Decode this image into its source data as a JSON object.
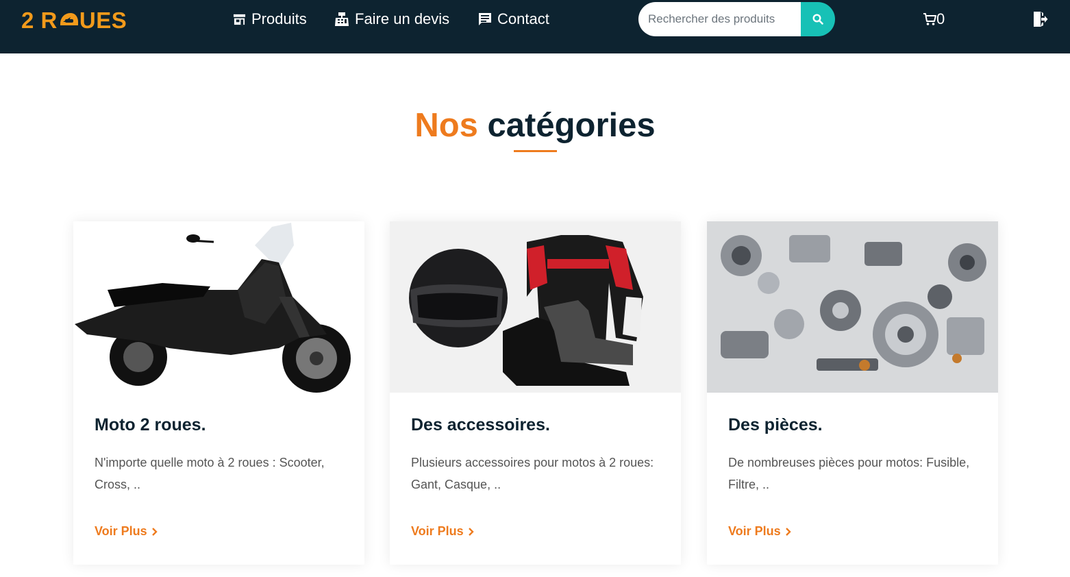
{
  "brand": {
    "logo_prefix": "2 R",
    "logo_suffix": "UES"
  },
  "nav": {
    "items": [
      {
        "label": "Produits",
        "icon": "store-icon"
      },
      {
        "label": "Faire un devis",
        "icon": "cash-register-icon"
      },
      {
        "label": "Contact",
        "icon": "message-icon"
      }
    ]
  },
  "search": {
    "placeholder": "Rechercher des produits",
    "value": ""
  },
  "cart": {
    "count": "0"
  },
  "section": {
    "title_accent": "Nos",
    "title_rest": "catégories"
  },
  "categories": [
    {
      "title": "Moto 2 roues.",
      "description": "N'importe quelle moto à 2 roues : Scooter, Cross, ..",
      "link": "Voir Plus"
    },
    {
      "title": "Des accessoires.",
      "description": "Plusieurs accessoires pour motos à 2 roues: Gant, Casque, ..",
      "link": "Voir Plus"
    },
    {
      "title": "Des pièces.",
      "description": "De nombreuses pièces pour motos: Fusible, Filtre, ..",
      "link": "Voir Plus"
    }
  ],
  "colors": {
    "navbar": "#0d2330",
    "logo": "#f29a1b",
    "accent": "#ee7b1e",
    "search_button": "#17c1b6"
  }
}
